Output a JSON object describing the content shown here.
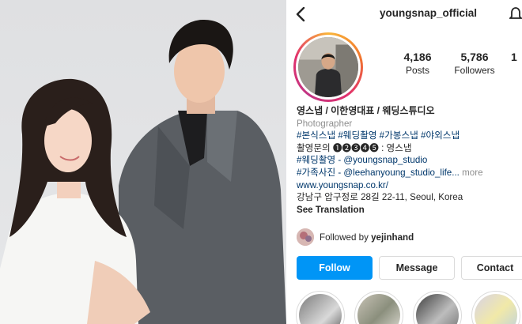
{
  "colors": {
    "accent_blue": "#0095f6",
    "link_blue": "#00376b",
    "text": "#262626",
    "muted": "#8e8e8e",
    "border": "#dbdbdb"
  },
  "photo": {
    "description_icon": "couple-photo"
  },
  "header": {
    "username": "youngsnap_official",
    "back_icon": "chevron-left-icon",
    "notification_icon": "bell-icon"
  },
  "stats": {
    "posts_count": "4,186",
    "posts_label": "Posts",
    "followers_count": "5,786",
    "followers_label": "Followers",
    "following_count": "1",
    "following_label": ""
  },
  "bio": {
    "name": "영스냅 / 이한영대표 / 웨딩스튜디오",
    "category": "Photographer",
    "hashtags_line": "#본식스냅 #웨딩촬영 #가봉스냅 #야외스냅",
    "inquiry_line": "촬영문의 ❶❷❸❹❺ : 영스냅",
    "wedding_line": "#웨딩촬영 - @youngsnap_studio",
    "family_line": "#가족사진 - @leehanyoung_studio_life...",
    "more_label": "more",
    "website": "www.youngsnap.co.kr/",
    "address": "강남구 압구정로 28길 22-11, Seoul, Korea",
    "see_translation": "See Translation"
  },
  "followed_by": {
    "prefix": "Followed by",
    "user": "yejinhand"
  },
  "buttons": {
    "follow": "Follow",
    "message": "Message",
    "contact": "Contact"
  }
}
